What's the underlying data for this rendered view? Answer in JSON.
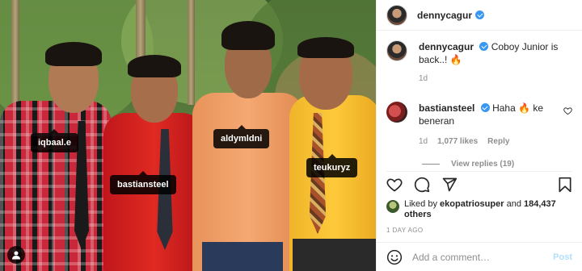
{
  "photo": {
    "tags": [
      {
        "label": "iqbaal.e"
      },
      {
        "label": "bastiansteel"
      },
      {
        "label": "aldymldni"
      },
      {
        "label": "teukuryz"
      }
    ],
    "user_tag_icon": "person-icon"
  },
  "post": {
    "author": "dennycagur",
    "verified": true,
    "caption_user": "dennycagur",
    "caption_text": "Coboy Junior is back..! 🔥",
    "caption_time": "1d"
  },
  "comment": {
    "user": "bastiansteel",
    "text": "Haha 🔥 ke beneran",
    "time": "1d",
    "likes": "1,077 likes",
    "reply_label": "Reply",
    "view_replies": "View replies (19)"
  },
  "actions": {
    "like_icon": "heart-icon",
    "comment_icon": "comment-icon",
    "share_icon": "send-icon",
    "save_icon": "bookmark-icon"
  },
  "likes": {
    "prefix": "Liked by",
    "user": "ekopatriosuper",
    "conj": "and",
    "count": "184,437 others"
  },
  "date_label": "1 DAY AGO",
  "comment_box": {
    "placeholder": "Add a comment…",
    "post_label": "Post",
    "emoji_icon": "smiley-icon"
  },
  "colors": {
    "verified": "#3897f0",
    "muted": "#8e8e8e",
    "post_disabled": "#b2dffc"
  }
}
